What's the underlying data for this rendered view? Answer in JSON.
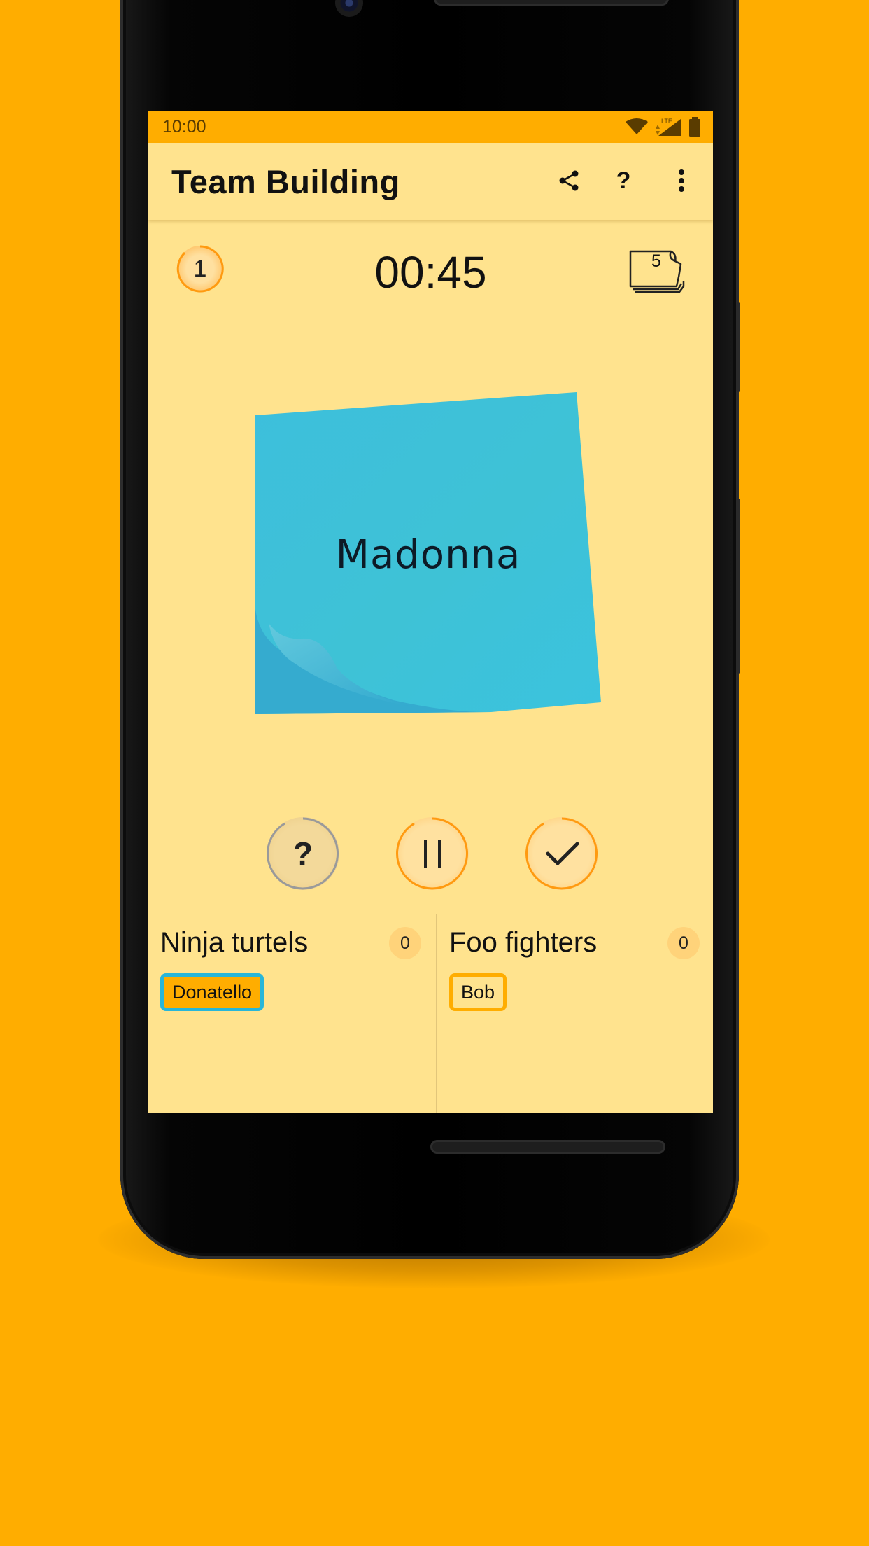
{
  "colors": {
    "background": "#FFAD00",
    "screen": "#FFE38E",
    "accent": "#FFAD00",
    "note": "#3CC3DB",
    "active_player_border": "#29B6D8"
  },
  "status_bar": {
    "time": "10:00",
    "icons": [
      "wifi-icon",
      "signal-lte-icon",
      "battery-icon"
    ],
    "network_label": "LTE"
  },
  "app_bar": {
    "title": "Team Building",
    "actions": [
      "share-icon",
      "help-icon",
      "more-vert-icon"
    ],
    "help_label": "?"
  },
  "game": {
    "round": "1",
    "timer": "00:45",
    "cards_left": "5",
    "current_word": "Madonna"
  },
  "controls": {
    "skip_label": "?",
    "pause_icon": "pause-icon",
    "correct_icon": "check-icon"
  },
  "teams": [
    {
      "name": "Ninja turtels",
      "score": "0",
      "players": [
        "Donatello"
      ],
      "active": true
    },
    {
      "name": "Foo fighters",
      "score": "0",
      "players": [
        "Bob"
      ],
      "active": false
    }
  ]
}
